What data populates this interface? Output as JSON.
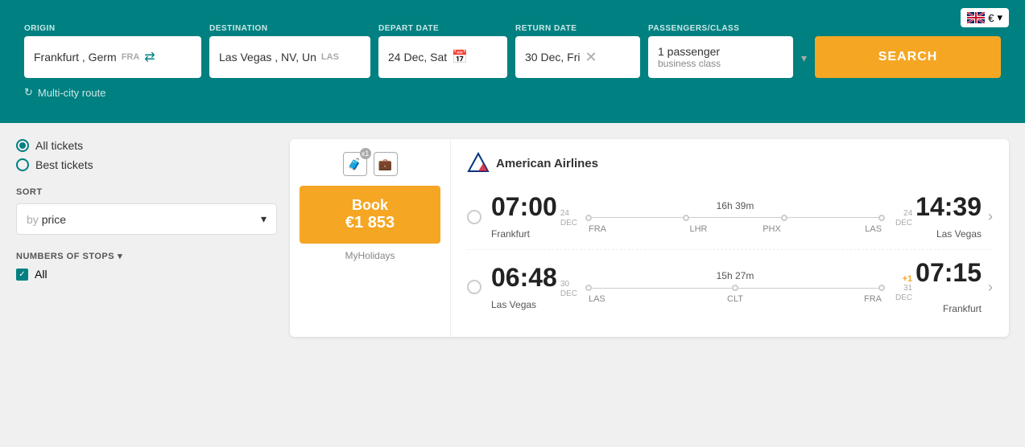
{
  "lang": {
    "flag": "GB",
    "currency": "€",
    "chevron": "▾"
  },
  "search": {
    "origin_label": "ORIGIN",
    "origin_value": "Frankfurt , Germ",
    "origin_code": "FRA",
    "destination_label": "DESTINATION",
    "destination_value": "Las Vegas , NV, Un",
    "destination_code": "LAS",
    "depart_label": "DEPART DATE",
    "depart_value": "24 Dec, Sat",
    "return_label": "RETURN DATE",
    "return_value": "30 Dec, Fri",
    "pax_label": "PASSENGERS/CLASS",
    "pax_value": "1 passenger",
    "class_value": "business class",
    "search_label": "SEARCH",
    "multi_city": "Multi-city route"
  },
  "filters": {
    "all_tickets": "All tickets",
    "best_tickets": "Best tickets",
    "sort_label": "SORT",
    "sort_by": "by",
    "sort_price": "price",
    "stops_label": "NUMBERS OF STOPS",
    "stops_all": "All"
  },
  "result": {
    "luggage1_count": "x1",
    "book_label": "Book",
    "price": "€1 853",
    "provider": "MyHolidays",
    "airline": "American Airlines",
    "outbound": {
      "dep_time": "07:00",
      "dep_day": "24",
      "dep_month": "DEC",
      "dep_city": "Frankfurt",
      "duration": "16h 39m",
      "stop1": "FRA",
      "stop2": "LHR",
      "stop3": "PHX",
      "stop4": "LAS",
      "arr_day": "24",
      "arr_month": "DEC",
      "arr_time": "14:39",
      "arr_city": "Las Vegas"
    },
    "inbound": {
      "dep_time": "06:48",
      "dep_day": "30",
      "dep_month": "DEC",
      "dep_city": "Las Vegas",
      "duration": "15h 27m",
      "stop1": "LAS",
      "stop2": "CLT",
      "stop3": "FRA",
      "arr_plus": "+1",
      "arr_day": "31",
      "arr_month": "DEC",
      "arr_time": "07:15",
      "arr_city": "Frankfurt"
    }
  }
}
